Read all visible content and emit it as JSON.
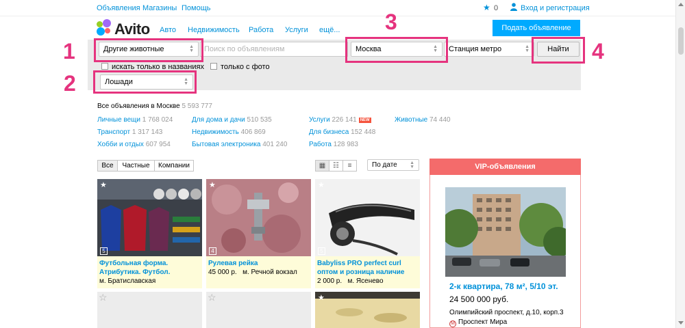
{
  "topbar": {
    "links": [
      "Объявления",
      "Магазины",
      "Помощь"
    ],
    "favorites_count": "0",
    "login_label": "Вход и регистрация"
  },
  "header": {
    "logo_text": "Avito",
    "nav": [
      "Авто",
      "Недвижимость",
      "Работа",
      "Услуги",
      "ещё..."
    ],
    "post_ad_label": "Подать объявление"
  },
  "search": {
    "category_value": "Другие животные",
    "query_placeholder": "Поиск по объявлениям",
    "city_value": "Москва",
    "metro_value": "Станция метро",
    "find_label": "Найти",
    "titles_only_label": "искать только в названиях",
    "photo_only_label": "только с фото",
    "subcategory_value": "Лошади"
  },
  "annotations": [
    "1",
    "2",
    "3",
    "4"
  ],
  "categories": {
    "title": "Все объявления в Москве",
    "total": "5 593 777",
    "items": [
      {
        "label": "Личные вещи",
        "count": "1 768 024"
      },
      {
        "label": "Транспорт",
        "count": "1 317 143"
      },
      {
        "label": "Хобби и отдых",
        "count": "607 954"
      },
      {
        "label": "Для дома и дачи",
        "count": "510 535"
      },
      {
        "label": "Недвижимость",
        "count": "406 869"
      },
      {
        "label": "Бытовая электроника",
        "count": "401 240"
      },
      {
        "label": "Услуги",
        "count": "226 141",
        "badge": "NEW"
      },
      {
        "label": "Для бизнеса",
        "count": "152 448"
      },
      {
        "label": "Работа",
        "count": "128 983"
      },
      {
        "label": "Животные",
        "count": "74 440"
      }
    ]
  },
  "listing": {
    "filters": [
      "Все",
      "Частные",
      "Компании"
    ],
    "sort_value": "По дате",
    "cards": [
      {
        "title": "Футбольная форма. Атрибутика. Футбол.",
        "price": "",
        "metro": "м. Братиславская",
        "photos": "5"
      },
      {
        "title": "Рулевая рейка",
        "price": "45 000 р.",
        "metro": "м. Речной вокзал",
        "photos": "4"
      },
      {
        "title": "Babyliss PRO perfect curl оптом и розница наличие",
        "price": "2 000 р.",
        "metro": "м. Ясенево",
        "photos": "5"
      }
    ]
  },
  "vip": {
    "header": "VIP-объявления",
    "title": "2-к квартира, 78 м², 5/10 эт.",
    "price": "24 500 000 руб.",
    "address": "Олимпийский проспект, д.10, корп.3",
    "metro": "Проспект Мира",
    "metro_badge": "М"
  },
  "colors": {
    "link": "#0091d9",
    "annotation": "#e5337e",
    "post_button": "#00aaff",
    "vip_header": "#f46b6b",
    "card_info": "#fefcd9"
  }
}
